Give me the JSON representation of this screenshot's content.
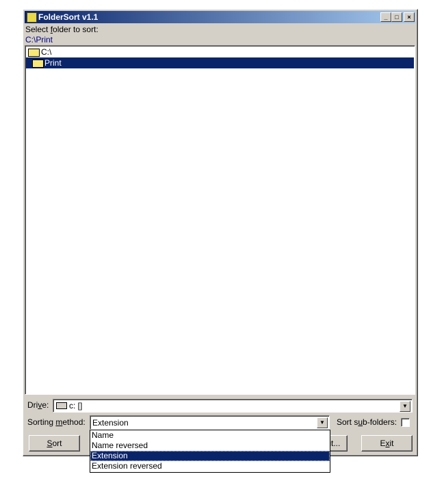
{
  "window": {
    "title": "FolderSort v1.1",
    "minimize": "_",
    "maximize": "□",
    "close": "×"
  },
  "select_label": {
    "pre": "Select ",
    "accel": "f",
    "post": "older to sort:"
  },
  "current_path": "C:\\Print",
  "tree": [
    {
      "label": "C:\\",
      "icon": "folder-open-icon",
      "selected": false
    },
    {
      "label": "Print",
      "icon": "folder-open-icon",
      "selected": true
    }
  ],
  "drive": {
    "label_pre": "Dri",
    "label_accel": "v",
    "label_post": "e:",
    "value": "c: []"
  },
  "sorting": {
    "label_pre": "Sorting ",
    "label_accel": "m",
    "label_post": "ethod:",
    "value": "Extension",
    "options": [
      "Name",
      "Name reversed",
      "Extension",
      "Extension reversed"
    ],
    "selected_index": 2
  },
  "subfolders": {
    "label_pre": "Sort s",
    "label_accel": "u",
    "label_post": "b-folders:",
    "checked": false
  },
  "buttons": {
    "sort_accel": "S",
    "sort_rest": "ort",
    "about_visible": "out...",
    "exit_pre": "E",
    "exit_accel": "x",
    "exit_post": "it"
  }
}
